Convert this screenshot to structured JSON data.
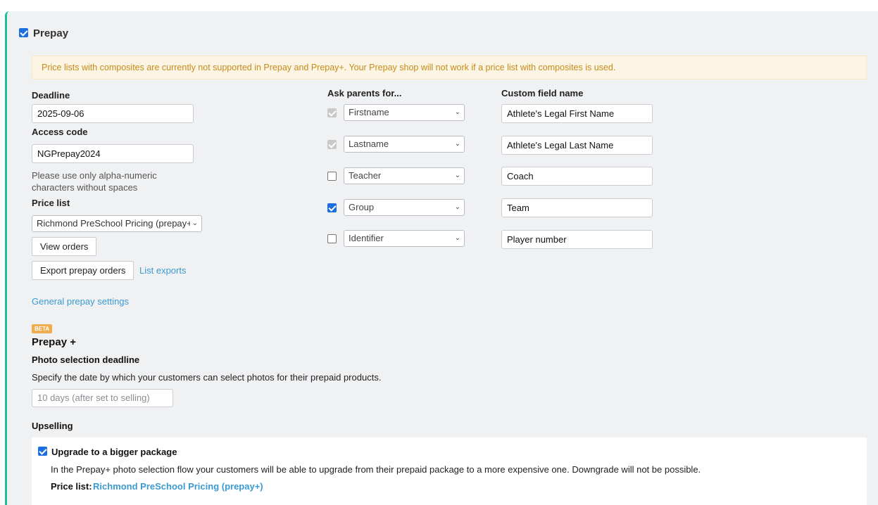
{
  "colors": {
    "accent_border": "#1fc09a",
    "checkbox_blue": "#1a6fe0",
    "link_blue": "#3a9ad1",
    "warning_bg": "#fdf5e4",
    "warning_text": "#c68a1c",
    "beta_badge": "#f0ad4e"
  },
  "section": {
    "title": "Prepay",
    "enabled": true
  },
  "warning": "Price lists with composites are currently not supported in Prepay and Prepay+. Your Prepay shop will not work if a price list with composites is used.",
  "deadline": {
    "label": "Deadline",
    "value": "2025-09-06"
  },
  "access_code": {
    "label": "Access code",
    "value": "NGPrepay2024",
    "hint_line1": "Please use only alpha-numeric",
    "hint_line2": "characters without spaces"
  },
  "price_list": {
    "label": "Price list",
    "selected": "Richmond PreSchool Pricing (prepay+)"
  },
  "buttons": {
    "view_orders": "View orders",
    "export_prepay_orders": "Export prepay orders"
  },
  "links": {
    "list_exports": "List exports",
    "general_settings": "General prepay settings"
  },
  "ask_parents": {
    "header": "Ask parents for...",
    "custom_header": "Custom field name",
    "rows": [
      {
        "field": "Firstname",
        "checked": true,
        "disabled": true,
        "custom": "Athlete's Legal First Name"
      },
      {
        "field": "Lastname",
        "checked": true,
        "disabled": true,
        "custom": "Athlete's Legal Last Name"
      },
      {
        "field": "Teacher",
        "checked": false,
        "disabled": false,
        "custom": "Coach"
      },
      {
        "field": "Group",
        "checked": true,
        "disabled": false,
        "custom": "Team"
      },
      {
        "field": "Identifier",
        "checked": false,
        "disabled": false,
        "custom": "Player number"
      }
    ]
  },
  "prepay_plus": {
    "badge": "BETA",
    "title": "Prepay +",
    "photo_deadline_label": "Photo selection deadline",
    "photo_deadline_desc": "Specify the date by which your customers can select photos for their prepaid products.",
    "photo_deadline_placeholder": "10 days (after set to selling)"
  },
  "upselling": {
    "label": "Upselling",
    "option_label": "Upgrade to a bigger package",
    "option_checked": true,
    "option_desc": "In the Prepay+ photo selection flow your customers will be able to upgrade from their prepaid package to a more expensive one. Downgrade will not be possible.",
    "price_list_label": "Price list:",
    "price_list_value": "Richmond PreSchool Pricing (prepay+)"
  }
}
